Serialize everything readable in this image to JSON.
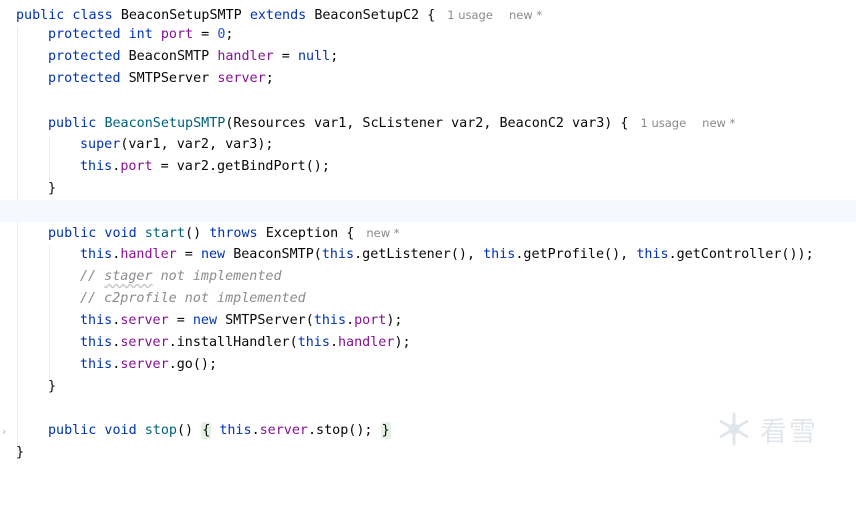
{
  "editor": {
    "gutter_fold_icon": "chevron-right-icon",
    "watermark_icon": "snowflake-icon",
    "watermark_text": "看雪",
    "lines": {
      "l1": {
        "t1": "public class ",
        "t2": "BeaconSetupSMTP ",
        "t3": "extends ",
        "t4": "BeaconSetupC2 {",
        "hint1": "1 usage",
        "hint2": "new *"
      },
      "l2": {
        "t1": "protected int ",
        "t2": "port",
        "t3": " = ",
        "t4": "0",
        "t5": ";"
      },
      "l3": {
        "t1": "protected ",
        "t2": "BeaconSMTP ",
        "t3": "handler",
        "t4": " = ",
        "t5": "null",
        "t6": ";"
      },
      "l4": {
        "t1": "protected ",
        "t2": "SMTPServer ",
        "t3": "server",
        "t4": ";"
      },
      "l6": {
        "t1": "public ",
        "t2": "BeaconSetupSMTP",
        "t3": "(Resources var1, ScListener var2, BeaconC2 var3) {",
        "hint1": "1 usage",
        "hint2": "new *"
      },
      "l7": {
        "t1": "super",
        "t2": "(var1, var2, var3);"
      },
      "l8": {
        "t1": "this",
        "t2": ".",
        "t3": "port",
        "t4": " = var2.getBindPort();"
      },
      "l9": {
        "t1": "}"
      },
      "l11": {
        "t1": "public void ",
        "t2": "start",
        "t3": "() ",
        "t4": "throws ",
        "t5": "Exception {",
        "hint1": "new *"
      },
      "l12": {
        "t1": "this",
        "t2": ".",
        "t3": "handler",
        "t4": " = ",
        "t5": "new ",
        "t6": "BeaconSMTP(",
        "t7": "this",
        "t8": ".getListener(), ",
        "t9": "this",
        "t10": ".getProfile(), ",
        "t11": "this",
        "t12": ".getController());"
      },
      "l13": {
        "t1": "// ",
        "t2": "stager",
        "t3": " not implemented"
      },
      "l14": {
        "t1": "// c2profile not implemented"
      },
      "l15": {
        "t1": "this",
        "t2": ".",
        "t3": "server",
        "t4": " = ",
        "t5": "new ",
        "t6": "SMTPServer(",
        "t7": "this",
        "t8": ".",
        "t9": "port",
        "t10": ");"
      },
      "l16": {
        "t1": "this",
        "t2": ".",
        "t3": "server",
        "t4": ".installHandler(",
        "t5": "this",
        "t6": ".",
        "t7": "handler",
        "t8": ");"
      },
      "l17": {
        "t1": "this",
        "t2": ".",
        "t3": "server",
        "t4": ".go();"
      },
      "l18": {
        "t1": "}"
      },
      "l20": {
        "t1": "public void ",
        "t2": "stop",
        "t3": "() ",
        "t4": "{",
        "t5": " ",
        "t6": "this",
        "t7": ".",
        "t8": "server",
        "t9": ".stop();",
        "t10": " ",
        "t11": "}"
      },
      "l21": {
        "t1": "}"
      }
    }
  }
}
